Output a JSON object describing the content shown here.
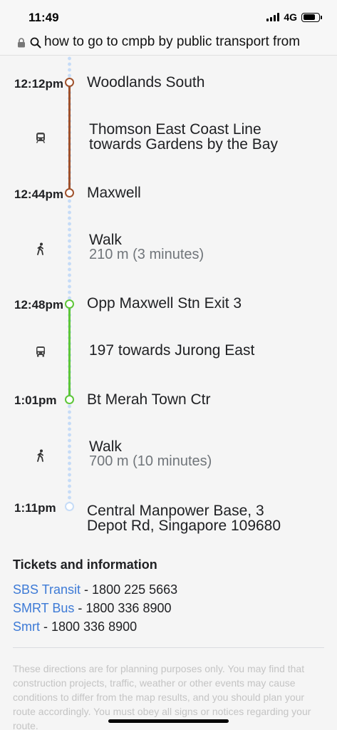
{
  "status": {
    "time": "11:49",
    "network": "4G",
    "battery_level": 0.8
  },
  "browser": {
    "url_text": "how to go to cmpb by public transport from"
  },
  "route": {
    "stops": [
      {
        "time": "12:12pm",
        "name": "Woodlands South"
      },
      {
        "time": "12:44pm",
        "name": "Maxwell"
      },
      {
        "time": "12:48pm",
        "name": "Opp Maxwell Stn Exit 3"
      },
      {
        "time": "1:01pm",
        "name": "Bt Merah Town Ctr"
      },
      {
        "time": "1:11pm",
        "name_line1": "Central Manpower Base, 3",
        "name_line2": "Depot Rd, Singapore 109680"
      }
    ],
    "steps": [
      {
        "icon": "train-icon",
        "line1": "Thomson East Coast Line",
        "line2": "towards Gardens by the Bay"
      },
      {
        "icon": "walk-icon",
        "title": "Walk",
        "detail": "210 m (3 minutes)"
      },
      {
        "icon": "bus-icon",
        "title": "197 towards Jurong East"
      },
      {
        "icon": "walk-icon",
        "title": "Walk",
        "detail": "700 m (10 minutes)"
      }
    ],
    "colors": {
      "train_line": "#a0522d",
      "bus_line": "#5ec639",
      "walk_dots": "#c6dcf7"
    }
  },
  "tickets": {
    "heading": "Tickets and information",
    "items": [
      {
        "name": "SBS Transit",
        "phone": " - 1800 225 5663"
      },
      {
        "name": "SMRT Bus",
        "phone": " - 1800 336 8900"
      },
      {
        "name": "Smrt",
        "phone": " - 1800 336 8900"
      }
    ],
    "link_color": "#3d7ad6"
  },
  "disclaimer": "These directions are for planning purposes only. You may find that construction projects, traffic, weather or other events may cause conditions to differ from the map results, and you should plan your route accordingly. You must obey all signs or notices regarding your route."
}
